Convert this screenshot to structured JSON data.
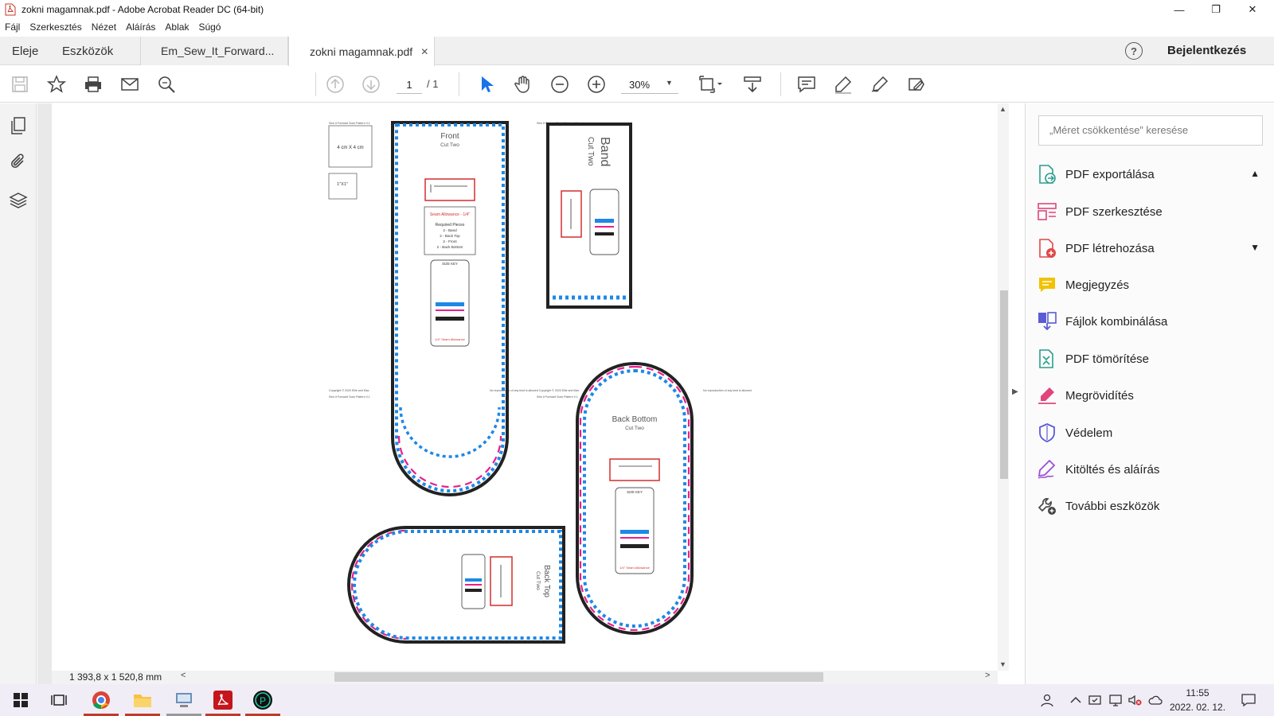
{
  "window": {
    "title": "zokni magamnak.pdf - Adobe Acrobat Reader DC (64-bit)",
    "minimize": "—",
    "restore": "❐",
    "close": "✕"
  },
  "menu": [
    "Fájl",
    "Szerkesztés",
    "Nézet",
    "Aláírás",
    "Ablak",
    "Súgó"
  ],
  "tabs": {
    "home": "Eleje",
    "tools": "Eszközök",
    "doc1": "Em_Sew_It_Forward...",
    "doc2": "zokni magamnak.pdf",
    "doc2_close": "✕",
    "help": "?",
    "login": "Bejelentkezés"
  },
  "toolbar": {
    "page_current": "1",
    "page_total": "/ 1",
    "zoom": "30%",
    "zoom_caret": "▼"
  },
  "document": {
    "dimensions": "1 393,8 x 1 520,8 mm",
    "pattern": {
      "front_title": "Front",
      "front_sub": "Cut Two",
      "band_title": "Band",
      "band_sub": "Cut Two",
      "backbottom_title": "Back Bottom",
      "backbottom_sub": "Cut Two",
      "backtop_title": "Back Top",
      "backtop_sub": "Cut Two",
      "square_label": "4 cm X 4 cm",
      "small_square_label": "1\"X1\"",
      "seam_allowance": "Seam Allowance - 1/4\"",
      "required_pieces_title": "Required Pieces",
      "required_pieces": [
        "2 - Band",
        "2 - Back Top",
        "2 - Front",
        "2 - Back Bottom"
      ],
      "size_key": "SIZE KEY",
      "seam_note": "1/4\" Seam Allowance"
    }
  },
  "right_panel": {
    "search_placeholder": "„Méret csökkentése” keresése",
    "tools": [
      {
        "label": "PDF exportálása",
        "icon": "export-pdf-icon",
        "color": "#2a9d8f"
      },
      {
        "label": "PDF szerkesztése",
        "icon": "edit-pdf-icon",
        "color": "#e0457b"
      },
      {
        "label": "PDF létrehozása",
        "icon": "create-pdf-icon",
        "color": "#e04848"
      },
      {
        "label": "Megjegyzés",
        "icon": "comment-icon",
        "color": "#f2c200"
      },
      {
        "label": "Fájlok kombinálása",
        "icon": "combine-files-icon",
        "color": "#5b5bd6"
      },
      {
        "label": "PDF tömörítése",
        "icon": "compress-pdf-icon",
        "color": "#2a9d8f"
      },
      {
        "label": "Megrövidítés",
        "icon": "redact-icon",
        "color": "#e0457b"
      },
      {
        "label": "Védelem",
        "icon": "protect-shield-icon",
        "color": "#5b5bd6"
      },
      {
        "label": "Kitöltés és aláírás",
        "icon": "fill-sign-icon",
        "color": "#9b4fd6"
      },
      {
        "label": "További eszközök",
        "icon": "more-tools-icon",
        "color": "#444444"
      }
    ]
  },
  "taskbar": {
    "time": "11:55",
    "date": "2022. 02. 12."
  }
}
